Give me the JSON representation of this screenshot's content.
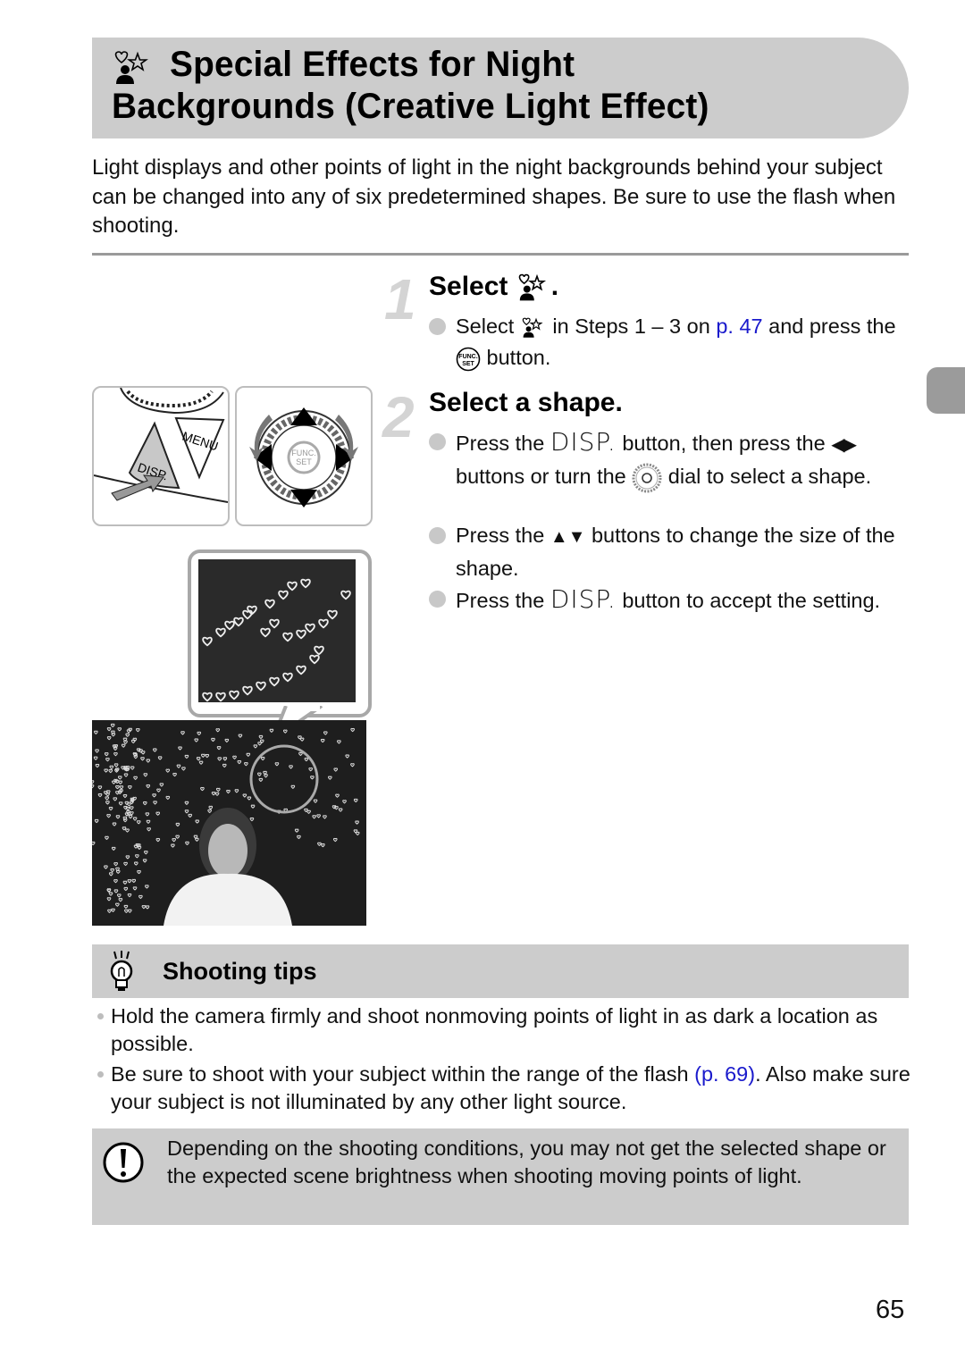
{
  "title": {
    "icon": "creative-light-effect-icon",
    "line1": "Special Effects for Night",
    "line2": "Backgrounds (Creative Light Effect)"
  },
  "intro": "Light displays and other points of light in the night backgrounds behind your subject can be changed into any of six predetermined shapes. Be sure to use the flash when shooting.",
  "steps": [
    {
      "number": "1",
      "title": "Select",
      "title_icon": "creative-light-effect-icon",
      "title_suffix": ".",
      "bullets": [
        {
          "parts": {
            "a": "Select",
            "icon": "creative-light-effect-icon",
            "b": "in Steps 1 – 3 on",
            "link": "p. 47",
            "c": "and press the",
            "button_icon": "func-set-button-icon",
            "d": "button."
          }
        }
      ]
    },
    {
      "number": "2",
      "title": "Select a shape.",
      "bullets": [
        {
          "parts": {
            "a": "Press the",
            "disp": "DISP.",
            "b": "button, then press the",
            "arrows": "◀▶",
            "c": "buttons or turn the",
            "dial_icon": "control-dial-icon",
            "d": "dial to select a shape."
          }
        },
        {
          "parts": {
            "a": "Press the",
            "arrows": "▲▼",
            "b": "buttons to change the size of the shape."
          }
        },
        {
          "parts": {
            "a": "Press the",
            "disp": "DISP.",
            "b": "button to accept the setting."
          }
        }
      ]
    }
  ],
  "illustrations": {
    "disp_button": {
      "menu_label": "MENU",
      "disp_label": "DISP."
    },
    "control_dial": {
      "center_label_1": "FUNC.",
      "center_label_2": "SET"
    }
  },
  "shooting_tips": {
    "title": "Shooting tips",
    "icon": "lightbulb-icon",
    "items": [
      {
        "text": "Hold the camera firmly and shoot nonmoving points of light in as dark a location as possible."
      },
      {
        "a": "Be sure to shoot with your subject within the range of the flash",
        "link": "(p. 69)",
        "b": ". Also make sure your subject is not illuminated by any other light source."
      }
    ]
  },
  "caution": {
    "icon": "caution-icon",
    "text": "Depending on the shooting conditions, you may not get the selected shape or the expected scene brightness when shooting moving points of light."
  },
  "page_number": "65",
  "colors": {
    "link": "#1a1acc",
    "banner": "#cccccc",
    "side_tab": "#9b9b9b"
  }
}
